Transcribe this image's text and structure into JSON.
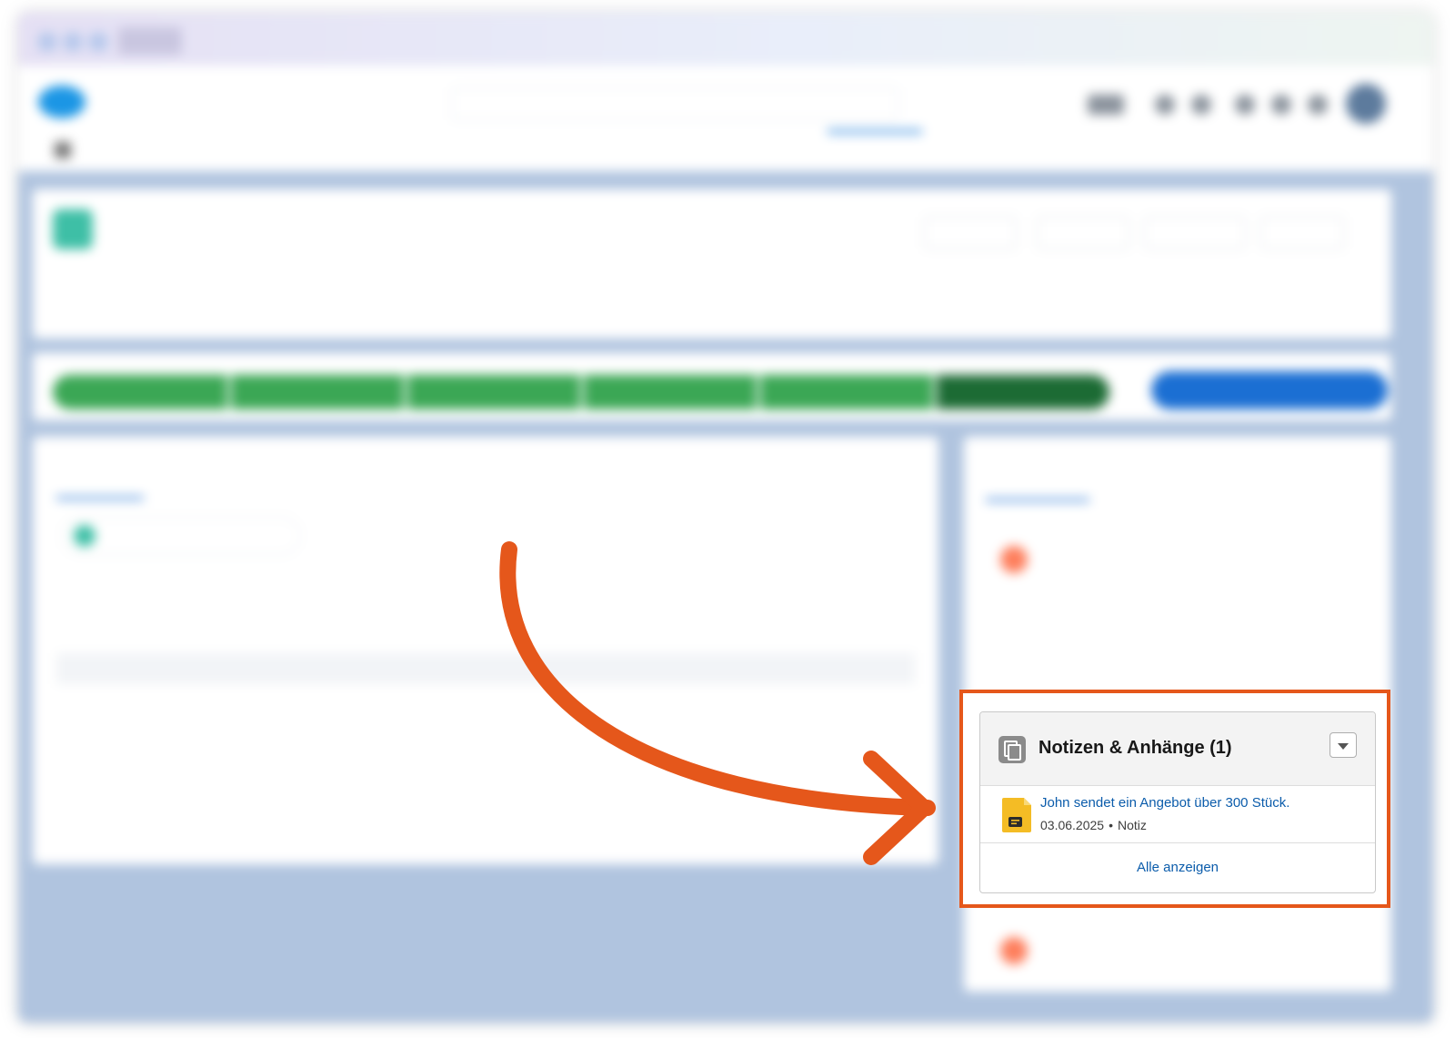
{
  "notes_card": {
    "title": "Notizen & Anhänge (1)",
    "notes": [
      {
        "title": "John sendet ein Angebot über 300 Stück.",
        "date": "03.06.2025",
        "separator": "•",
        "type": "Notiz",
        "icon": "note-icon"
      }
    ],
    "view_all_label": "Alle anzeigen"
  },
  "colors": {
    "highlight": "#e5571b",
    "link": "#0b5cab",
    "path_complete": "#3ba755",
    "path_current": "#1c6b34",
    "background_area": "#b0c4df",
    "note_icon": "#f4bc25"
  },
  "icons": {
    "card_icon": "notes-attachments-icon",
    "dropdown": "chevron-down-icon",
    "annotation": "curved-arrow-icon"
  }
}
